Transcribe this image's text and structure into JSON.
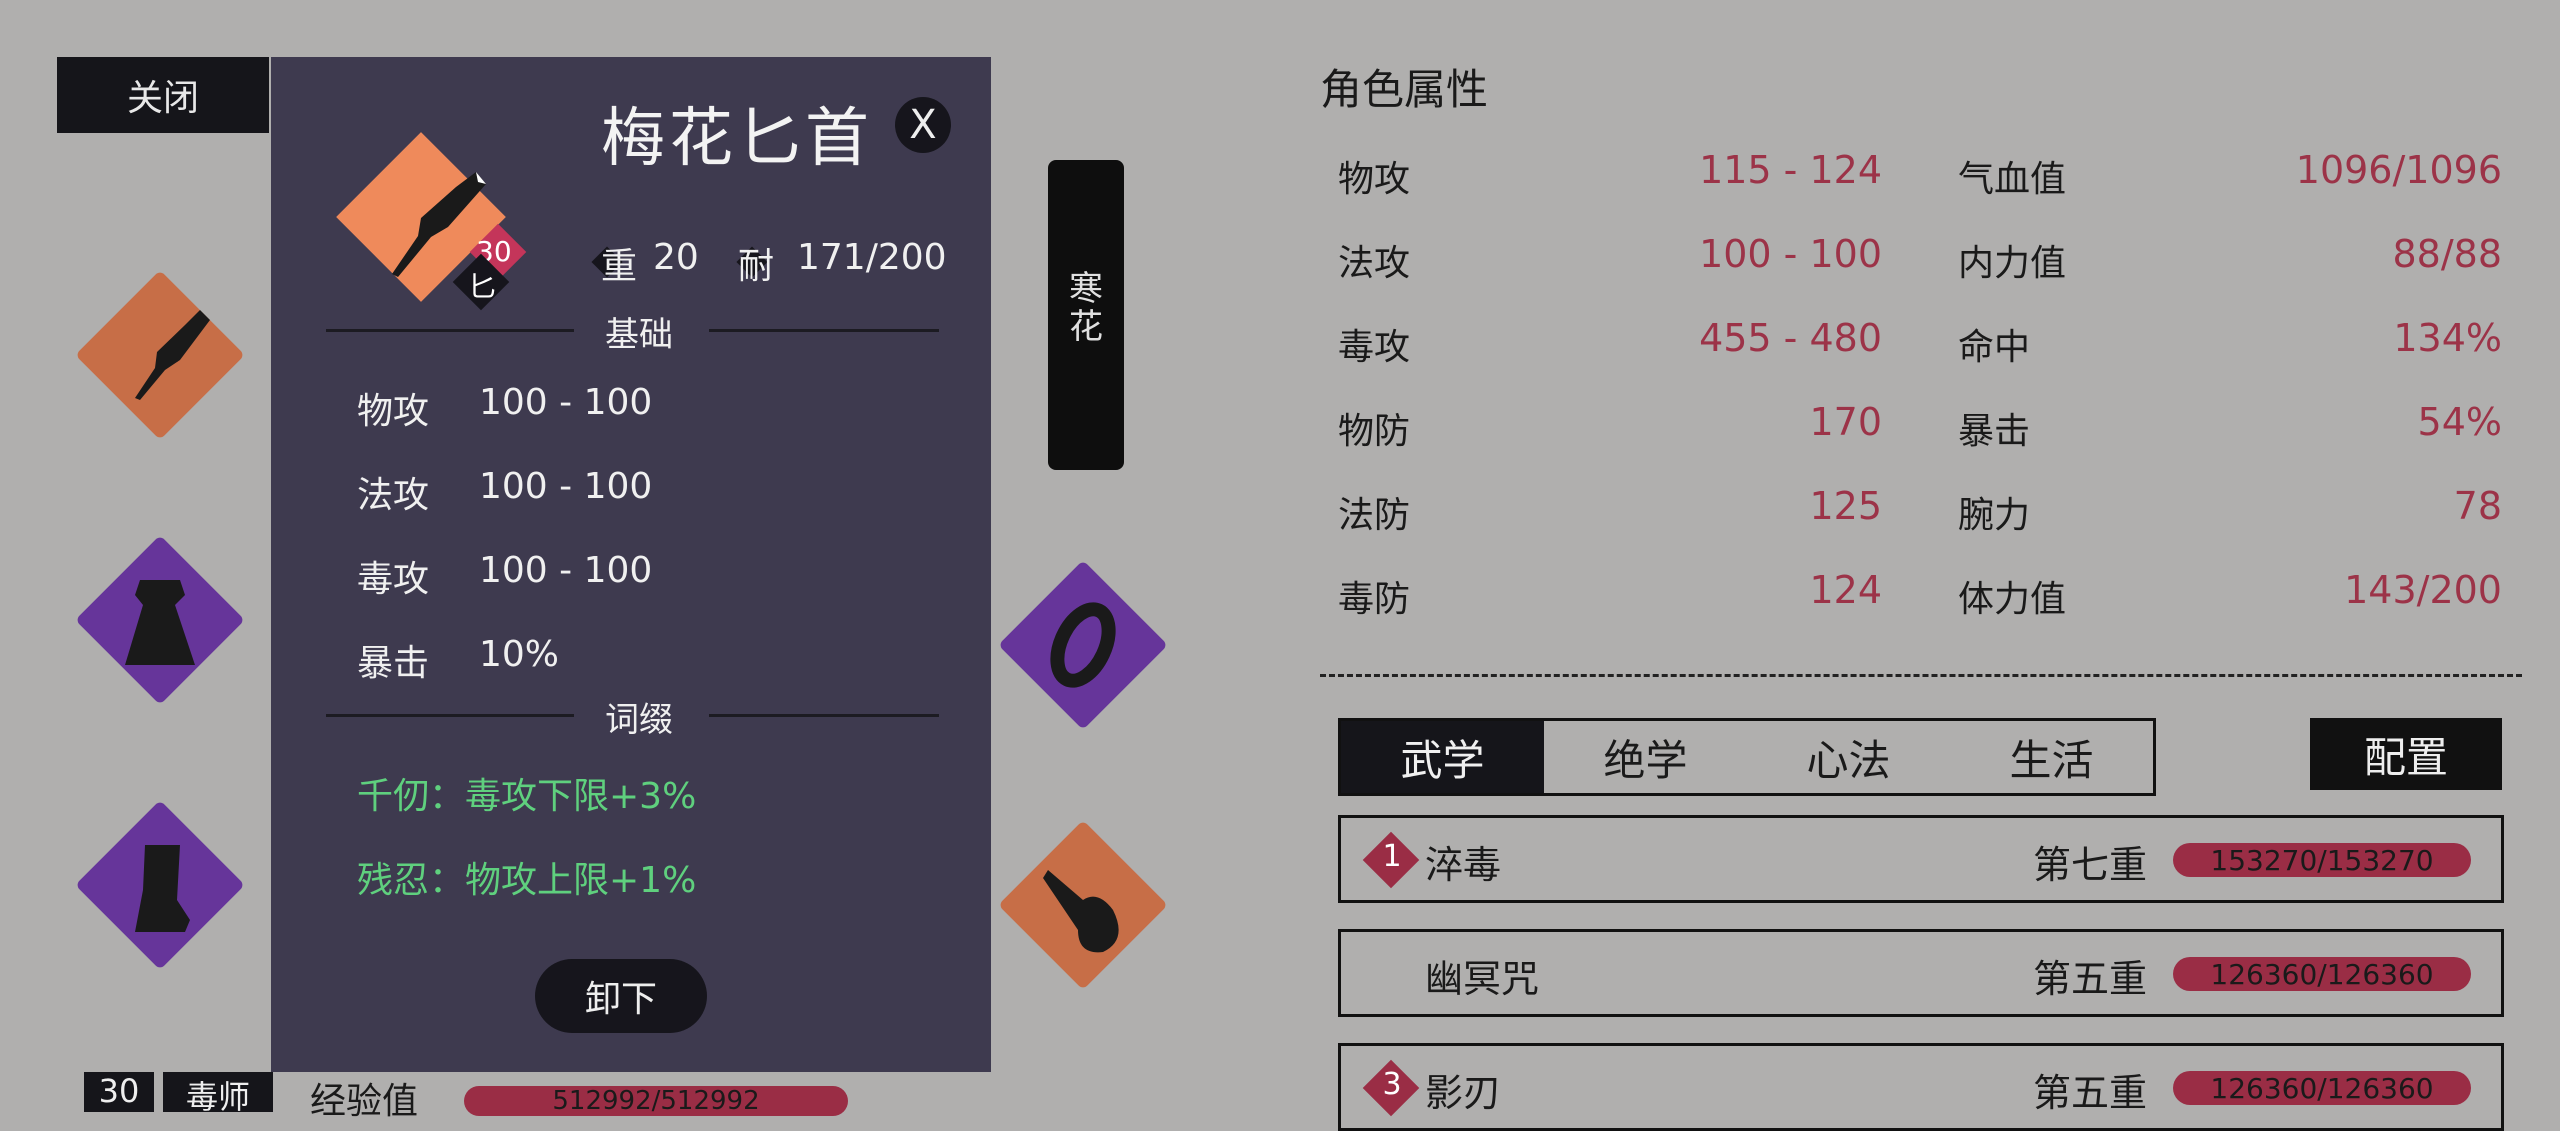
{
  "close_button": "关闭",
  "banner_text": "寒花",
  "tooltip": {
    "title": "梅花匕首",
    "close": "X",
    "level": "30",
    "type": "匕",
    "weight_label": "重",
    "weight_value": "20",
    "durability_label": "耐",
    "durability_value": "171/200",
    "base_section": "基础",
    "base_stats": [
      {
        "label": "物攻",
        "value": "100 - 100"
      },
      {
        "label": "法攻",
        "value": "100 - 100"
      },
      {
        "label": "毒攻",
        "value": "100 - 100"
      },
      {
        "label": "暴击",
        "value": "10%"
      }
    ],
    "affix_section": "词缀",
    "affixes": [
      "千仞：毒攻下限+3%",
      "残忍：物攻上限+1%"
    ],
    "unequip": "卸下"
  },
  "attributes": {
    "title": "角色属性",
    "left": [
      {
        "label": "物攻",
        "value": "115 - 124"
      },
      {
        "label": "法攻",
        "value": "100 - 100"
      },
      {
        "label": "毒攻",
        "value": "455 - 480"
      },
      {
        "label": "物防",
        "value": "170"
      },
      {
        "label": "法防",
        "value": "125"
      },
      {
        "label": "毒防",
        "value": "124"
      }
    ],
    "right": [
      {
        "label": "气血值",
        "value": "1096/1096"
      },
      {
        "label": "内力值",
        "value": "88/88"
      },
      {
        "label": "命中",
        "value": "134%"
      },
      {
        "label": "暴击",
        "value": "54%"
      },
      {
        "label": "腕力",
        "value": "78"
      },
      {
        "label": "体力值",
        "value": "143/200"
      }
    ]
  },
  "tabs": [
    "武学",
    "绝学",
    "心法",
    "生活"
  ],
  "active_tab": "武学",
  "config_button": "配置",
  "skills": [
    {
      "num": "1",
      "name": "淬毒",
      "level": "第七重",
      "exp": "153270/153270"
    },
    {
      "num": "",
      "name": "幽冥咒",
      "level": "第五重",
      "exp": "126360/126360"
    },
    {
      "num": "3",
      "name": "影刃",
      "level": "第五重",
      "exp": "126360/126360"
    }
  ],
  "bottom": {
    "level": "30",
    "job": "毒师",
    "exp_label": "经验值",
    "exp_value": "512992/512992"
  },
  "colors": {
    "accent": "#9a2d45",
    "affix": "#5fd07e",
    "panel": "#3e3a4f",
    "background": "#b0afae"
  },
  "icons": {
    "slot_1": "dagger-icon",
    "slot_2": "robe-icon",
    "slot_3": "boots-icon",
    "slot_4": "ring-icon",
    "slot_5": "gourd-icon"
  }
}
